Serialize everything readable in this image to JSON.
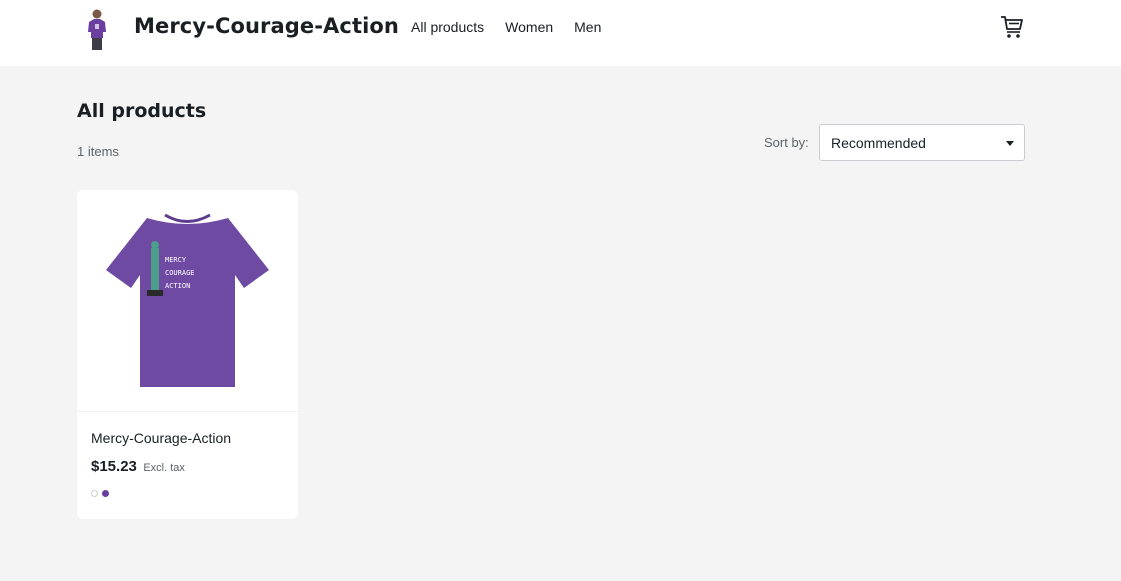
{
  "header": {
    "brand": "Mercy-Courage-Action",
    "nav": [
      "All products",
      "Women",
      "Men"
    ],
    "cart_icon": "cart-icon"
  },
  "main": {
    "title": "All products",
    "count": "1 items",
    "sort": {
      "label": "Sort by:",
      "value": "Recommended"
    }
  },
  "products": [
    {
      "name": "Mercy-Courage-Action",
      "price": "$15.23",
      "tax_note": "Excl. tax",
      "shirt_print": [
        "MERCY",
        "COURAGE",
        "ACTION"
      ],
      "colors": [
        "#ffffff",
        "#6a3fa0"
      ]
    }
  ]
}
